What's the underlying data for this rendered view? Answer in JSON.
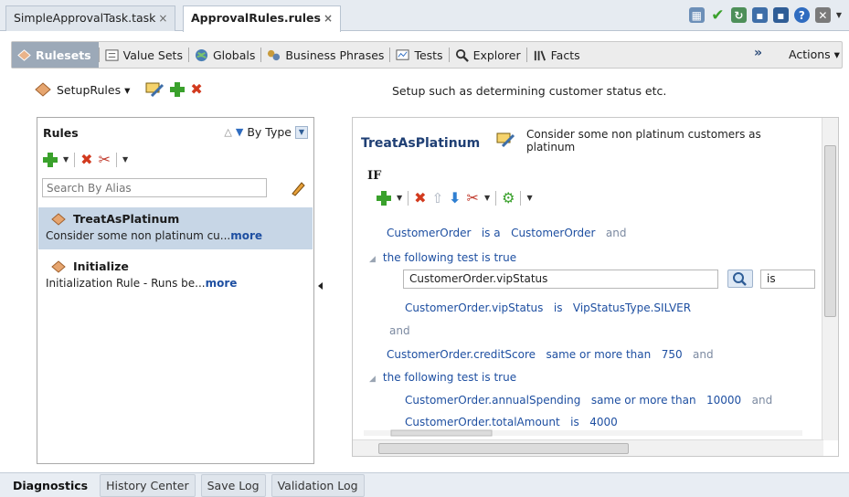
{
  "editor_tabs": [
    {
      "label": "SimpleApprovalTask.task",
      "close": "×",
      "active": false
    },
    {
      "label": "ApprovalRules.rules",
      "close": "×",
      "active": true
    }
  ],
  "toolbar_icons": [
    "chart-icon",
    "check-icon",
    "deploy-icon",
    "save-icon",
    "save-all-icon",
    "help-icon",
    "close-window-icon"
  ],
  "nav": {
    "items": [
      "Rulesets",
      "Value Sets",
      "Globals",
      "Business Phrases",
      "Tests",
      "Explorer",
      "Facts"
    ],
    "overflow": "»",
    "actions": "Actions ▾"
  },
  "ruleset": {
    "name": "SetupRules ▾",
    "description": "Setup such as determining customer status etc."
  },
  "rules_panel": {
    "title": "Rules",
    "sort_label": "By Type",
    "search_placeholder": "Search By Alias",
    "rules": [
      {
        "name": "TreatAsPlatinum",
        "desc": "Consider some non platinum cu...",
        "more": "more",
        "selected": true
      },
      {
        "name": "Initialize",
        "desc": "Initialization Rule - Runs be...",
        "more": "more",
        "selected": false
      }
    ]
  },
  "rule_editor": {
    "title": "TreatAsPlatinum",
    "description": "Consider some non platinum customers as platinum",
    "if_label": "IF",
    "lines": {
      "l1_a": "CustomerOrder",
      "l1_b": "is a",
      "l1_c": "CustomerOrder",
      "l1_d": "and",
      "l2": "the following test is true",
      "expr_value": "CustomerOrder.vipStatus",
      "op_value": "is",
      "l4_a": "CustomerOrder.vipStatus",
      "l4_b": "is",
      "l4_c": "VipStatusType.SILVER",
      "l5": "and",
      "l6_a": "CustomerOrder.creditScore",
      "l6_b": "same or more than",
      "l6_c": "750",
      "l6_d": "and",
      "l7": "the following test is true",
      "l8_a": "CustomerOrder.annualSpending",
      "l8_b": "same or more than",
      "l8_c": "10000",
      "l8_d": "and",
      "l9_a": "CustomerOrder.totalAmount",
      "l9_b": "is",
      "l9_c": "4000"
    }
  },
  "bottom_tabs": [
    {
      "label": "Diagnostics",
      "active": true
    },
    {
      "label": "History Center",
      "active": false
    },
    {
      "label": "Save Log",
      "active": false
    },
    {
      "label": "Validation Log",
      "active": false
    }
  ]
}
